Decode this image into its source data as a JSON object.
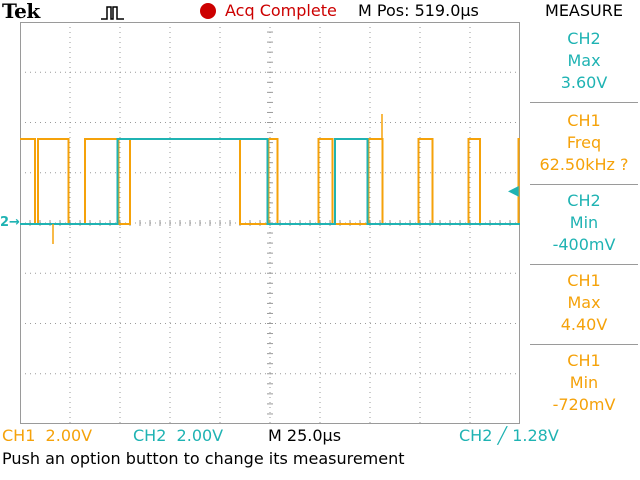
{
  "header": {
    "brand": "Tek",
    "trigger_icon": "pulse-waveform-icon",
    "run_indicator_color": "#cc0000",
    "acquisition_status": "Acq Complete",
    "main_position": "M Pos: 519.0µs",
    "side_menu_title": "MEASURE"
  },
  "colors": {
    "ch1": "#f5a20a",
    "ch2": "#1fb3b3",
    "grid": "#9a9a9a",
    "background": "#ffffff"
  },
  "measurements": [
    {
      "channel": "CH2",
      "type": "Max",
      "value": "3.60V"
    },
    {
      "channel": "CH1",
      "type": "Freq",
      "value": "62.50kHz ?"
    },
    {
      "channel": "CH2",
      "type": "Min",
      "value": "-400mV"
    },
    {
      "channel": "CH1",
      "type": "Max",
      "value": "4.40V"
    },
    {
      "channel": "CH1",
      "type": "Min",
      "value": "-720mV"
    }
  ],
  "status_bar": {
    "ch1_scale": "CH1  2.00V",
    "ch2_scale": "CH2  2.00V",
    "timebase": "M 25.0µs",
    "trigger": "CH2 ╱ 1.28V"
  },
  "help_text": "Push an option button to change its measurement",
  "ch2_ground_marker": "2→",
  "chart_data": {
    "type": "line",
    "x_divisions": 10,
    "y_divisions": 8,
    "x_unit": "div",
    "y_unit": "div",
    "grid": true,
    "series": [
      {
        "name": "CH1",
        "x": [
          0,
          0.3,
          0.3,
          0.36,
          0.36,
          0.97,
          0.97,
          1.3,
          1.3,
          1.97,
          1.97,
          2.2,
          2.2,
          2.3,
          2.3,
          4.4,
          4.4,
          4.97,
          4.97,
          5.15,
          5.15,
          5.97,
          5.97,
          6.25,
          6.25,
          6.97,
          6.97,
          7.25,
          7.25,
          7.97,
          7.97,
          8.25,
          8.25,
          8.97,
          8.97,
          9.2,
          9.2,
          9.97,
          9.97,
          10
        ],
        "y": [
          1.7,
          1.7,
          0,
          0,
          1.7,
          1.7,
          0,
          0,
          1.7,
          1.7,
          0,
          0,
          1.7,
          1.7,
          1.7,
          1.7,
          0,
          0,
          1.7,
          1.7,
          0,
          0,
          1.7,
          1.7,
          0,
          0,
          1.7,
          1.7,
          0,
          0,
          1.7,
          1.7,
          0,
          0,
          1.7,
          1.7,
          0,
          0,
          1.7,
          1.7
        ]
      },
      {
        "name": "CH2",
        "x": [
          0,
          1.95,
          1.95,
          4.95,
          4.95,
          6.3,
          6.3,
          6.95,
          6.95,
          10
        ],
        "y": [
          0,
          0,
          1.7,
          1.7,
          0,
          0,
          1.7,
          1.7,
          0,
          0
        ]
      }
    ]
  }
}
